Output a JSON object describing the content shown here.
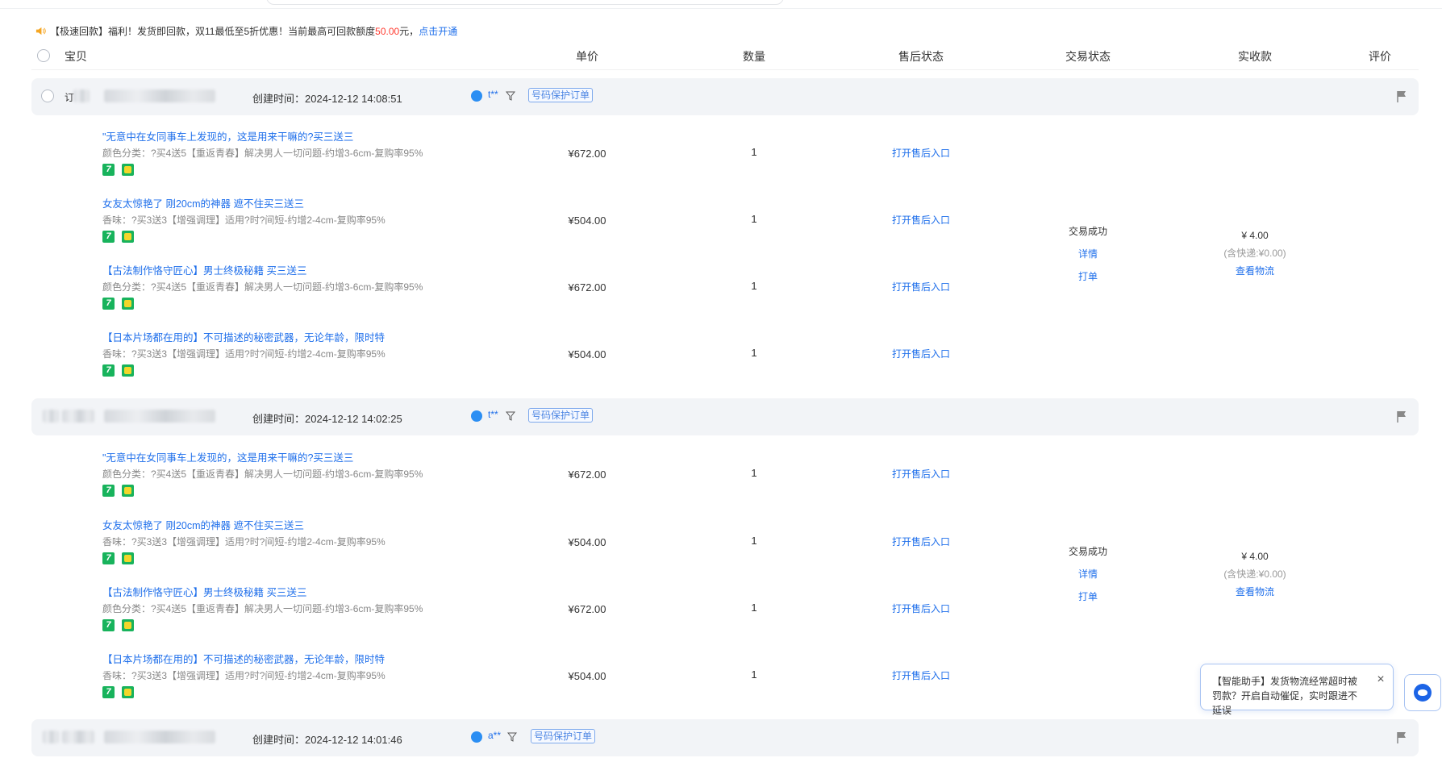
{
  "notice": {
    "prefix": "【极速回款】福利！发货即回款，双11最低至5折优惠！当前最高可回款额度",
    "amount": "50.00",
    "unit": "元，",
    "link": "点击开通"
  },
  "columns": {
    "item": "宝贝",
    "price": "单价",
    "qty": "数量",
    "after": "售后状态",
    "trade": "交易状态",
    "paid": "实收款",
    "review": "评价"
  },
  "orders": [
    {
      "id_prefix": "订",
      "created": "创建时间：2024-12-12 14:08:51",
      "buyer": "t**",
      "badge": "号码保护订单",
      "items": [
        {
          "title": "\"无意中在女同事车上发现的，这是用来干嘛的?买三送三",
          "spec": "颜色分类：?买4送5【重返青春】解决男人一切问题-约增3-6cm-复购率95%",
          "price": "¥672.00",
          "qty": "1",
          "after": "打开售后入口"
        },
        {
          "title": "女友太惊艳了 刚20cm的神器 遮不住买三送三",
          "spec": "香味：?买3送3【增强调理】适用?时?间短-约增2-4cm-复购率95%",
          "price": "¥504.00",
          "qty": "1",
          "after": "打开售后入口"
        },
        {
          "title": "【古法制作恪守匠心】男士终极秘籍 买三送三",
          "spec": "颜色分类：?买4送5【重返青春】解决男人一切问题-约增3-6cm-复购率95%",
          "price": "¥672.00",
          "qty": "1",
          "after": "打开售后入口"
        },
        {
          "title": "【日本片场都在用的】不可描述的秘密武器，无论年龄，限时特",
          "spec": "香味：?买3送3【增强调理】适用?时?间短-约增2-4cm-复购率95%",
          "price": "¥504.00",
          "qty": "1",
          "after": "打开售后入口"
        }
      ],
      "trade": {
        "status": "交易成功",
        "detail": "详情",
        "print": "打单"
      },
      "pay": {
        "amount": "¥ 4.00",
        "shipping": "(含快递:¥0.00)",
        "logistics": "查看物流"
      }
    },
    {
      "id_prefix": "",
      "created": "创建时间：2024-12-12 14:02:25",
      "buyer": "t**",
      "badge": "号码保护订单",
      "items": [
        {
          "title": "\"无意中在女同事车上发现的，这是用来干嘛的?买三送三",
          "spec": "颜色分类：?买4送5【重返青春】解决男人一切问题-约增3-6cm-复购率95%",
          "price": "¥672.00",
          "qty": "1",
          "after": "打开售后入口"
        },
        {
          "title": "女友太惊艳了 刚20cm的神器 遮不住买三送三",
          "spec": "香味：?买3送3【增强调理】适用?时?间短-约增2-4cm-复购率95%",
          "price": "¥504.00",
          "qty": "1",
          "after": "打开售后入口"
        },
        {
          "title": "【古法制作恪守匠心】男士终极秘籍 买三送三",
          "spec": "颜色分类：?买4送5【重返青春】解决男人一切问题-约增3-6cm-复购率95%",
          "price": "¥672.00",
          "qty": "1",
          "after": "打开售后入口"
        },
        {
          "title": "【日本片场都在用的】不可描述的秘密武器，无论年龄，限时特",
          "spec": "香味：?买3送3【增强调理】适用?时?间短-约增2-4cm-复购率95%",
          "price": "¥504.00",
          "qty": "1",
          "after": "打开售后入口"
        }
      ],
      "trade": {
        "status": "交易成功",
        "detail": "详情",
        "print": "打单"
      },
      "pay": {
        "amount": "¥ 4.00",
        "shipping": "(含快递:¥0.00)",
        "logistics": "查看物流"
      }
    },
    {
      "id_prefix": "",
      "created": "创建时间：2024-12-12 14:01:46",
      "buyer": "a**",
      "badge": "号码保护订单",
      "items": []
    }
  ],
  "assistant": {
    "text": "【智能助手】发货物流经常超时被罚款？开启自动催促，实时跟进不延误",
    "close": "×"
  }
}
